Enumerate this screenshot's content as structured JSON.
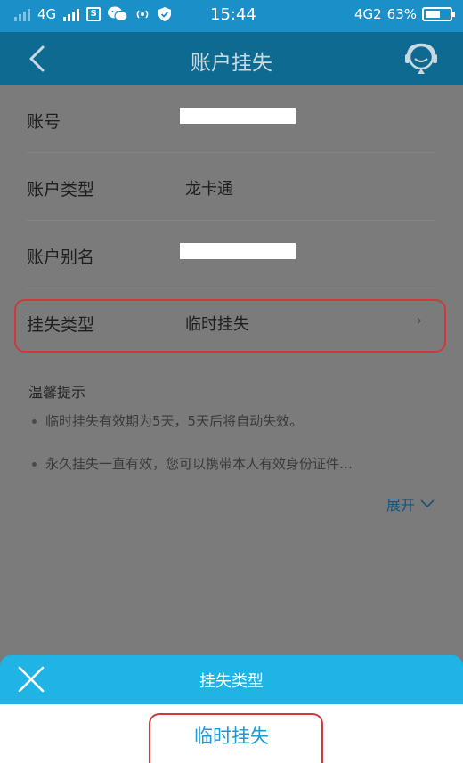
{
  "status_bar": {
    "network_left": "4G",
    "time": "15:44",
    "network_right": "4G2",
    "battery_percent": "63%",
    "battery_level": 0.63,
    "icons": [
      "signal-bars-icon",
      "sim-icon",
      "wechat-icon",
      "hotspot-icon",
      "shield-icon",
      "battery-icon"
    ]
  },
  "nav": {
    "title": "账户挂失",
    "back_icon": "back-icon",
    "service_icon": "customer-service-icon"
  },
  "form": {
    "rows": [
      {
        "label": "账号",
        "value": ""
      },
      {
        "label": "账户类型",
        "value": "龙卡通"
      },
      {
        "label": "账户别名",
        "value": ""
      },
      {
        "label": "挂失类型",
        "value": "临时挂失"
      }
    ]
  },
  "tips": {
    "title": "温馨提示",
    "items": [
      "临时挂失有效期为5天，5天后将自动失效。",
      "永久挂失一直有效，您可以携带本人有效身份证件…"
    ],
    "expand_label": "展开"
  },
  "sheet": {
    "title": "挂失类型",
    "option": "临时挂失"
  },
  "colors": {
    "status_bar": "#1a8fc8",
    "nav_bar": "#0f6a92",
    "sheet_header": "#1fb3e6",
    "highlight_border": "#d0393b",
    "link": "#14537a"
  }
}
